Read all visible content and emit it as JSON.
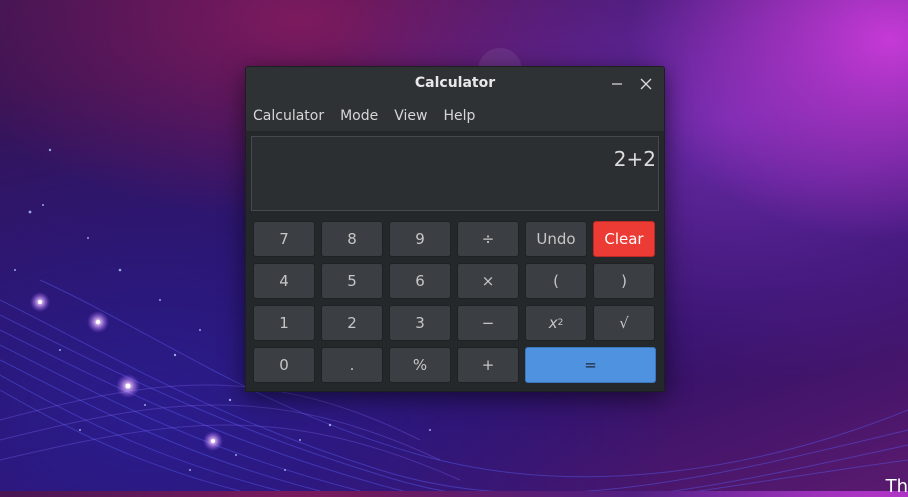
{
  "window": {
    "title": "Calculator"
  },
  "menubar": {
    "items": [
      "Calculator",
      "Mode",
      "View",
      "Help"
    ]
  },
  "display": {
    "expression": "2+2"
  },
  "keypad": {
    "row1": [
      "7",
      "8",
      "9",
      "÷",
      "Undo",
      "Clear"
    ],
    "row2": [
      "4",
      "5",
      "6",
      "×",
      "(",
      ")"
    ],
    "row3": [
      "1",
      "2",
      "3",
      "−",
      "x",
      "√"
    ],
    "row3_square_exponent": "2",
    "row4": [
      "0",
      ".",
      "%",
      "+",
      "="
    ]
  },
  "colors": {
    "clear_button": "#ec3a34",
    "equals_button": "#4f92e0",
    "window_bg": "#2e3134"
  },
  "desktop": {
    "corner_text": "Th"
  }
}
